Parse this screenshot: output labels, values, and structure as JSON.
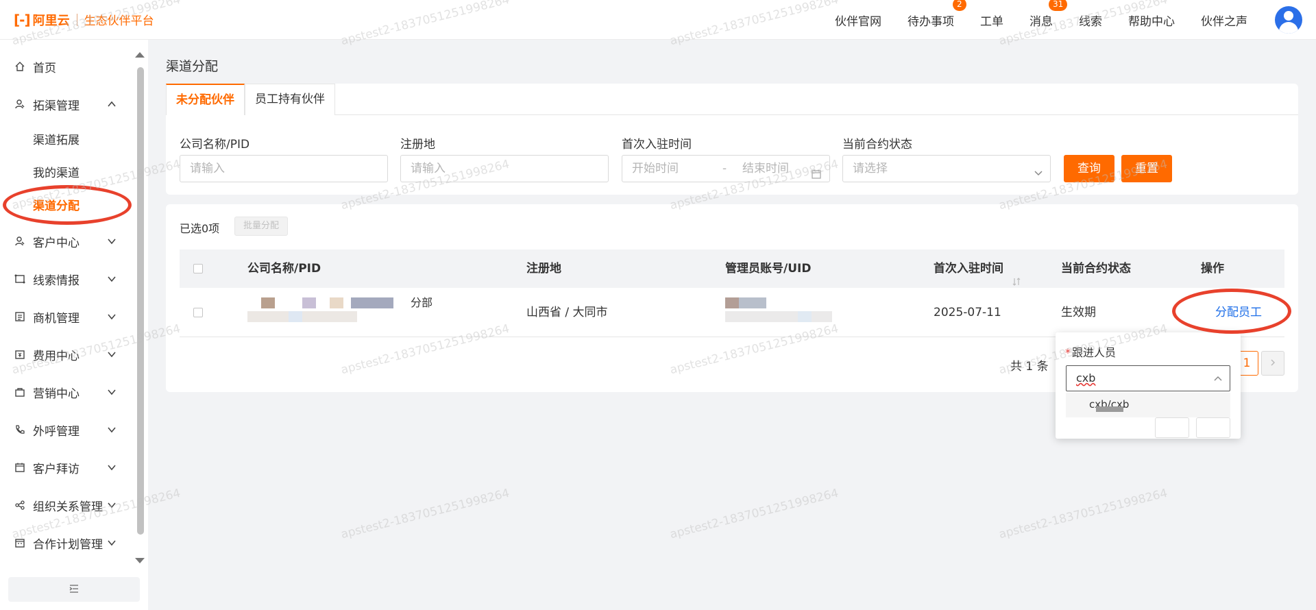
{
  "header": {
    "logo_text": "阿里云",
    "platform_name": "生态伙伴平台",
    "nav": [
      {
        "label": "伙伴官网",
        "badge": ""
      },
      {
        "label": "待办事项",
        "badge": "2"
      },
      {
        "label": "工单",
        "badge": ""
      },
      {
        "label": "消息",
        "badge": "31"
      },
      {
        "label": "线索",
        "badge": ""
      },
      {
        "label": "帮助中心",
        "badge": ""
      },
      {
        "label": "伙伴之声",
        "badge": ""
      }
    ]
  },
  "sidebar": {
    "items": [
      {
        "label": "首页",
        "icon": "home-icon"
      },
      {
        "label": "拓渠管理",
        "icon": "partner-icon",
        "expanded": true,
        "children": [
          {
            "label": "渠道拓展"
          },
          {
            "label": "我的渠道"
          },
          {
            "label": "渠道分配",
            "active": true
          }
        ]
      },
      {
        "label": "客户中心",
        "icon": "customer-icon"
      },
      {
        "label": "线索情报",
        "icon": "lead-icon"
      },
      {
        "label": "商机管理",
        "icon": "opportunity-icon"
      },
      {
        "label": "费用中心",
        "icon": "fee-icon"
      },
      {
        "label": "营销中心",
        "icon": "marketing-icon"
      },
      {
        "label": "外呼管理",
        "icon": "phone-icon"
      },
      {
        "label": "客户拜访",
        "icon": "calendar-icon"
      },
      {
        "label": "组织关系管理",
        "icon": "share-icon"
      },
      {
        "label": "合作计划管理",
        "icon": "plan-icon"
      }
    ]
  },
  "page": {
    "title": "渠道分配",
    "tabs": [
      {
        "label": "未分配伙伴",
        "active": true
      },
      {
        "label": "员工持有伙伴",
        "active": false
      }
    ],
    "filters": {
      "company_label": "公司名称/PID",
      "company_placeholder": "请输入",
      "region_label": "注册地",
      "region_placeholder": "请输入",
      "first_join_label": "首次入驻时间",
      "start_placeholder": "开始时间",
      "range_sep": "-",
      "end_placeholder": "结束时间",
      "status_label": "当前合约状态",
      "status_placeholder": "请选择",
      "query_button": "查询",
      "reset_button": "重置"
    },
    "table": {
      "selected_text": "已选0项",
      "batch_button": "批量分配",
      "columns": [
        "公司名称/PID",
        "注册地",
        "管理员账号/UID",
        "首次入驻时间",
        "当前合约状态",
        "操作"
      ],
      "rows": [
        {
          "company_suffix": "分部",
          "region": "山西省 / 大同市",
          "first_join": "2025-07-11",
          "status": "生效期",
          "action": "分配员工"
        }
      ],
      "total_text": "共 1 条",
      "current_page": "1"
    },
    "popover": {
      "required_mark": "*",
      "label": "跟进人员",
      "input_value": "cxb",
      "option": "cxb/cxb"
    }
  },
  "watermark": "apstest2-1837051251998264",
  "colors": {
    "brand": "#ff6a00",
    "link": "#1f6fe8",
    "annotation": "#e8412c"
  }
}
